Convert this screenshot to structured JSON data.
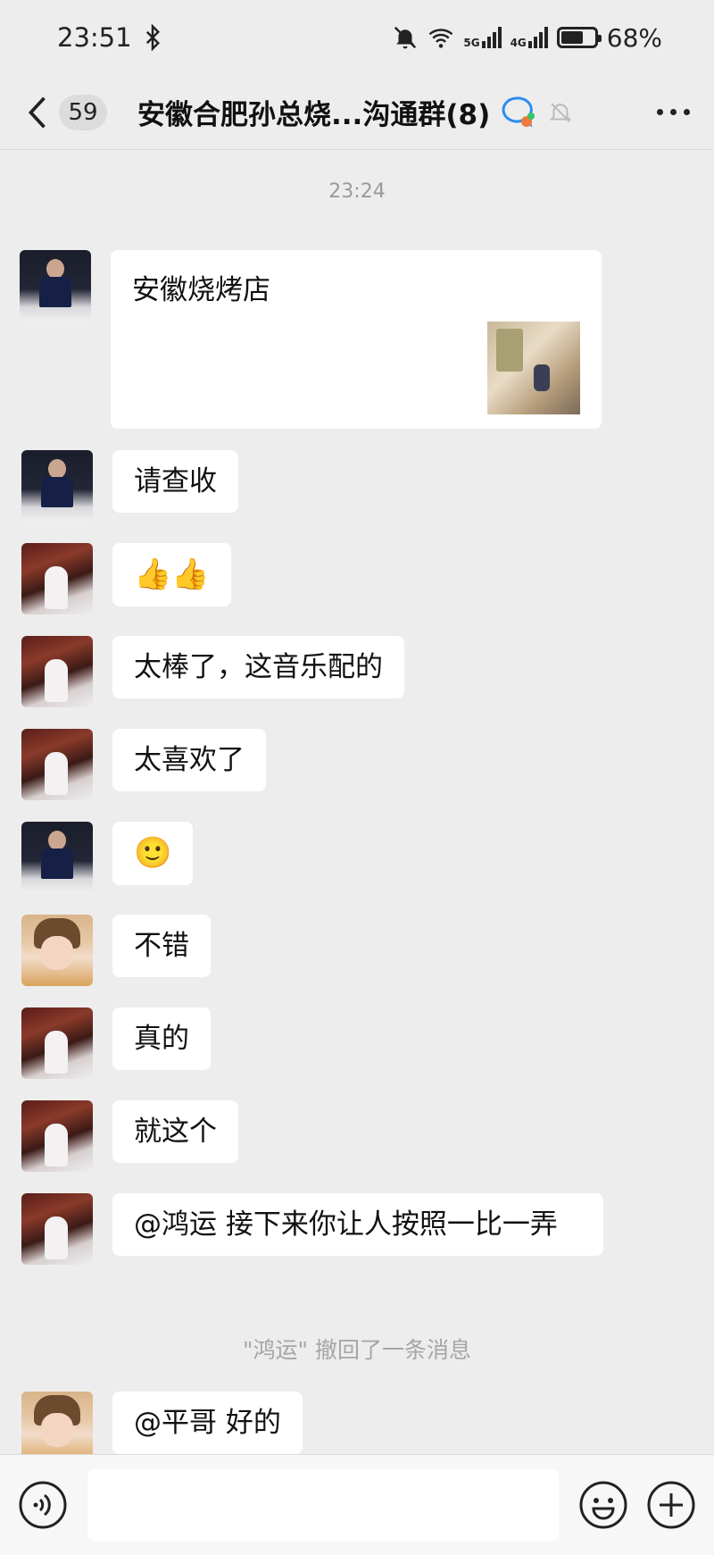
{
  "status_bar": {
    "time": "23:51",
    "network_5g": "5G",
    "network_4g": "4G",
    "battery_percent_text": "68%",
    "battery_level": 0.68
  },
  "header": {
    "unread_count": "59",
    "title": "安徽合肥孙总烧...沟通群(8)"
  },
  "chat": {
    "timestamp": "23:24",
    "link_message_text": "安徽烧烤店",
    "messages": [
      {
        "text": "请查收"
      },
      {
        "text": "👍👍"
      },
      {
        "text": "太棒了，这音乐配的"
      },
      {
        "text": "太喜欢了"
      },
      {
        "text": "🙂"
      },
      {
        "text": "不错"
      },
      {
        "text": "真的"
      },
      {
        "text": "就这个"
      },
      {
        "text": "@鸿运  接下来你让人按照一比一弄"
      },
      {
        "text": "@平哥  好的"
      }
    ],
    "system_notice": "\"鸿运\" 撤回了一条消息"
  },
  "input_bar": {
    "placeholder": ""
  },
  "icons": {
    "back": "back-icon",
    "group": "group-chat-icon",
    "mute": "mute-icon",
    "more": "more-icon",
    "voice": "voice-icon",
    "emoji": "emoji-icon",
    "plus": "plus-icon"
  },
  "colors": {
    "background": "#ededed",
    "bubble": "#ffffff",
    "input_bar": "#f7f7f7"
  }
}
